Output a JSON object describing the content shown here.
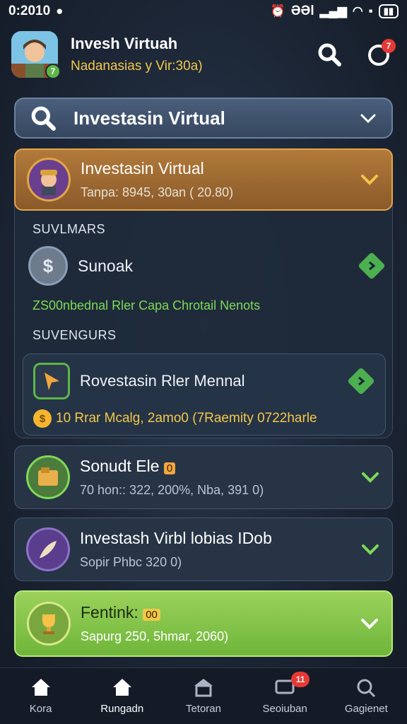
{
  "status_bar": {
    "time": "0:2010",
    "network_text": "ƏƏl"
  },
  "header": {
    "title": "Invesh Virtuah",
    "subtitle": "Nadanasias y Vir:30a)",
    "avatar_level": "7",
    "notification_count": "7"
  },
  "search": {
    "label": "Investasin Virtual"
  },
  "selected_card": {
    "title": "Investasin Virtual",
    "subtitle": "Tanpa: 8945, 30an ( 20.80)"
  },
  "section_1": {
    "label": "SUVLMARS",
    "item": {
      "title": "Sunoak"
    },
    "note": "ZS00nbednal Rler Capa Chrotail Nenots"
  },
  "section_2": {
    "label": "SUVENGURS",
    "card": {
      "title": "Rovestasin Rler Mennal",
      "footer": "10 Rrar Mcalg, 2amo0 (7Raemity 0722harle"
    }
  },
  "list": [
    {
      "title": "Sonudt Ele",
      "badge": "0",
      "subtitle": "70 hon:: 322, 200%, Nba, 391 0)"
    },
    {
      "title": "Investash Virbl lobias IDob",
      "subtitle": "Sopir Phbc 320 0)"
    }
  ],
  "final_card": {
    "title": "Fentink:",
    "badge": "00",
    "subtitle": "Sapurg 250, 5hmar, 2060)"
  },
  "tabbar": {
    "tabs": [
      {
        "label": "Kora"
      },
      {
        "label": "Rungadn"
      },
      {
        "label": "Tetoran"
      },
      {
        "label": "Seoiuban",
        "badge": "11"
      },
      {
        "label": "Gagienet"
      }
    ]
  },
  "colors": {
    "background": "#1c2636",
    "selected_card": "#b27a3a",
    "highlight_card": "#8bc34a",
    "accent_yellow": "#f2c84b",
    "accent_green": "#7ed957",
    "badge_red": "#e53935"
  },
  "icons": {
    "search": "search-icon",
    "notification": "bell-icon",
    "coin": "coin-icon",
    "trophy": "trophy-icon",
    "home": "home-icon"
  }
}
